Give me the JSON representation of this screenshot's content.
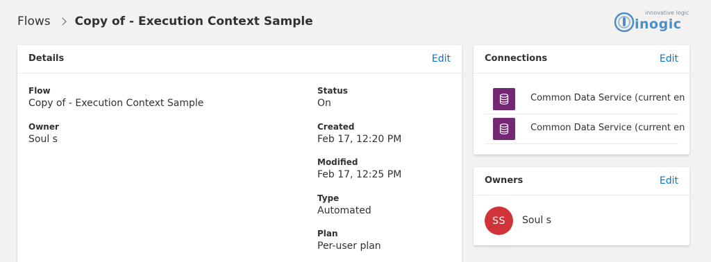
{
  "breadcrumb": {
    "root": "Flows",
    "current": "Copy of - Execution Context Sample"
  },
  "logo": {
    "tagline": "innovative logic",
    "wordmark": "inogic"
  },
  "details": {
    "title": "Details",
    "edit_label": "Edit",
    "flow_label": "Flow",
    "flow_value": "Copy of - Execution Context Sample",
    "owner_label": "Owner",
    "owner_value": "Soul s",
    "status_label": "Status",
    "status_value": "On",
    "created_label": "Created",
    "created_value": "Feb 17, 12:20 PM",
    "modified_label": "Modified",
    "modified_value": "Feb 17, 12:25 PM",
    "type_label": "Type",
    "type_value": "Automated",
    "plan_label": "Plan",
    "plan_value": "Per-user plan"
  },
  "connections": {
    "title": "Connections",
    "edit_label": "Edit",
    "items": [
      {
        "name": "Common Data Service (current en",
        "icon": "database-icon"
      },
      {
        "name": "Common Data Service (current en",
        "icon": "database-icon"
      }
    ]
  },
  "owners": {
    "title": "Owners",
    "edit_label": "Edit",
    "items": [
      {
        "initials": "SS",
        "name": "Soul s"
      }
    ]
  },
  "colors": {
    "accent": "#0078d4",
    "connector": "#742774",
    "avatar": "#d13438",
    "background": "#f3f2f1"
  }
}
